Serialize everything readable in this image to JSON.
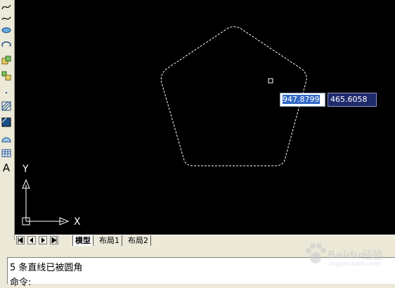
{
  "toolbar": {
    "icons": [
      "spline-icon",
      "ellipse-icon",
      "ellipse-arc-icon",
      "insert-block-icon",
      "make-block-icon",
      "point-icon",
      "hatch-icon",
      "gradient-icon",
      "region-icon",
      "table-icon",
      "multiline-text-icon"
    ],
    "text_tool_label": "A"
  },
  "canvas": {
    "background": "#000000",
    "dynamic_input": {
      "x_value": "947.8799",
      "y_value": "465.6058"
    },
    "ucs": {
      "x_label": "X",
      "y_label": "Y"
    }
  },
  "tabs": {
    "model": "模型",
    "layout1": "布局1",
    "layout2": "布局2"
  },
  "command": {
    "line1": "5  条直线已被圆角",
    "line2": "命令:"
  },
  "watermark": {
    "text": "Baidu经验",
    "sub": "jingyan.baidu.com"
  }
}
